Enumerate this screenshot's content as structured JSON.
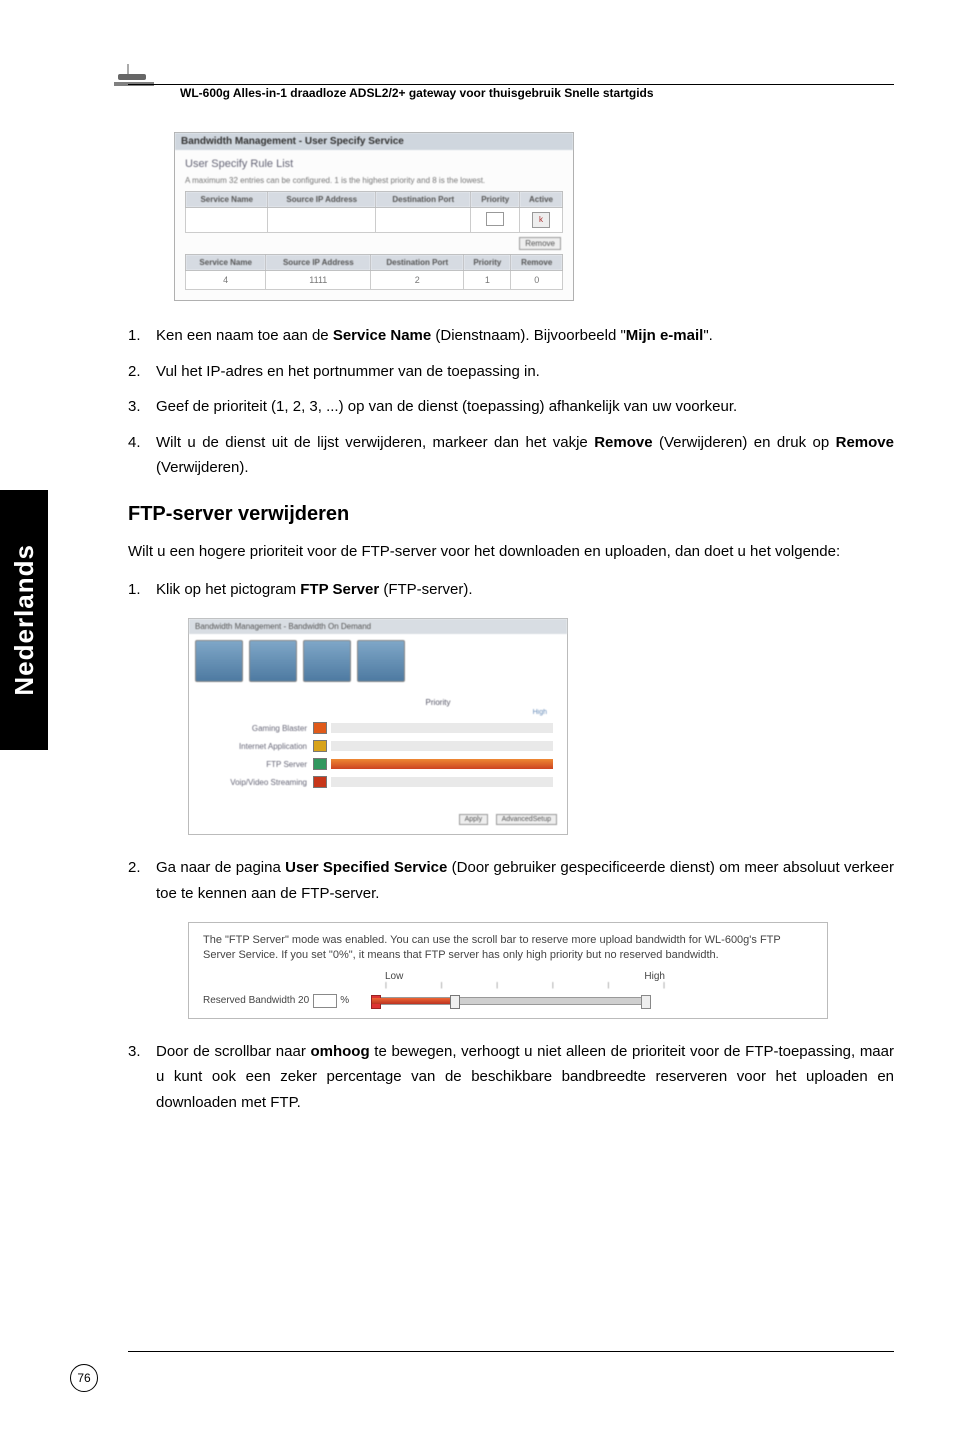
{
  "header": {
    "product_line": "WL-600g Alles-in-1 draadloze ADSL2/2+ gateway voor thuisgebruik Snelle startgids"
  },
  "sidebar_tab": "Nederlands",
  "page_number": "76",
  "shot1": {
    "title": "Bandwidth Management - User Specify Service",
    "subtitle": "User Specify Rule List",
    "desc": "A maximum 32 entries can be configured. 1 is the highest priority and 8 is the lowest.",
    "cols": [
      "Service Name",
      "Source IP Address",
      "Destination Port",
      "Priority",
      "Active"
    ],
    "cols2": [
      "Service Name",
      "Source IP Address",
      "Destination Port",
      "Priority",
      "Remove"
    ],
    "row2": [
      "4",
      "1111",
      "2",
      "1",
      "0"
    ],
    "remove_btn": "Remove"
  },
  "list1": [
    {
      "n": "1.",
      "html": "Ken een naam toe aan de <b>Service Name</b> (Dienstnaam). Bijvoorbeeld \"<b>Mijn e-mail</b>\"."
    },
    {
      "n": "2.",
      "html": "Vul het IP-adres en het portnummer van de toepassing in."
    },
    {
      "n": "3.",
      "html": "Geef de prioriteit (1, 2, 3, ...) op van de dienst (toepassing) afhankelijk van uw voorkeur."
    },
    {
      "n": "4.",
      "html": "Wilt u de dienst uit de lijst verwijderen, markeer dan het vakje <b>Remove</b> (Verwijderen) en druk op <b>Remove</b> (Verwijderen)."
    }
  ],
  "section_h": "FTP-server verwijderen",
  "section_intro": "Wilt u een hogere prioriteit voor de FTP-server voor het downloaden en uploaden, dan doet u het volgende:",
  "list2_item1": {
    "n": "1.",
    "html": "Klik op het pictogram <b>FTP Server</b> (FTP-server)."
  },
  "shot2": {
    "title": "Bandwidth Management - Bandwidth On Demand",
    "priority_label": "Priority",
    "high_label": "High",
    "rows": [
      {
        "label": "Gaming Blaster",
        "color": "#e05a1a",
        "fill": 0
      },
      {
        "label": "Internet Application",
        "color": "#d8a31a",
        "fill": 0
      },
      {
        "label": "FTP Server",
        "color": "#31975f",
        "fill": 100
      },
      {
        "label": "Voip/Video Streaming",
        "color": "#c7361a",
        "fill": 0
      }
    ],
    "btn1": "Apply",
    "btn2": "AdvancedSetup"
  },
  "list2_item2": {
    "n": "2.",
    "html": "Ga naar de pagina <b>User Specified Service</b> (Door gebruiker gespecificeerde dienst) om meer absoluut verkeer toe te kennen aan de FTP-server."
  },
  "shot3": {
    "desc": "The \"FTP Server\" mode was enabled. You can use the scroll bar to reserve more upload bandwidth for WL-600g's FTP Server Service. If you set \"0%\", it means that FTP server has only high priority but no reserved bandwidth.",
    "low": "Low",
    "high": "High",
    "reserved_label": "Reserved Bandwidth 20",
    "percent_suffix": "%"
  },
  "list2_item3": {
    "n": "3.",
    "html": "Door de scrollbar naar <b>omhoog</b> te bewegen, verhoogt u niet alleen de prioriteit voor de FTP-toepassing, maar u kunt ook een zeker percentage van de beschikbare bandbreedte reserveren voor het uploaden en downloaden met FTP."
  }
}
